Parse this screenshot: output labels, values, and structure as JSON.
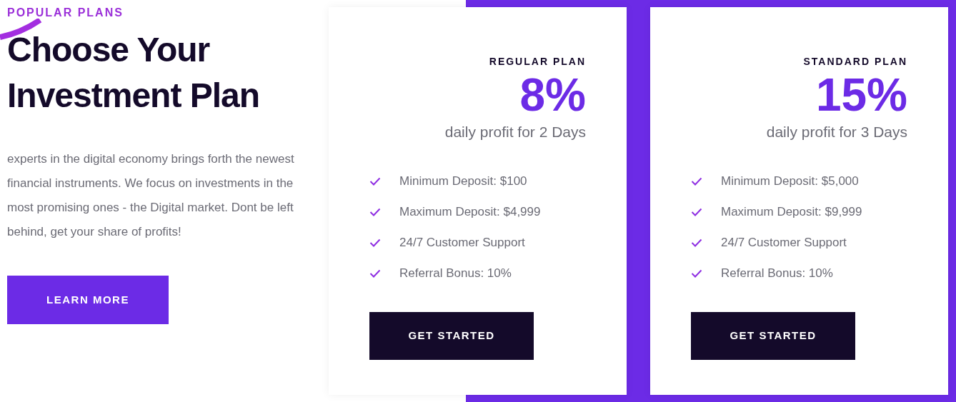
{
  "section": {
    "eyebrow": "POPULAR PLANS",
    "heading": "Choose Your Investment Plan",
    "text": "experts in the digital economy brings forth the newest financial instruments. We focus on investments in the most promising ones - the Digital market. Dont be left behind, get your share of profits!",
    "button": "LEARN MORE"
  },
  "plans": [
    {
      "name": "REGULAR PLAN",
      "rate": "8%",
      "period": "daily profit for 2 Days",
      "features": [
        "Minimum Deposit: $100",
        "Maximum Deposit: $4,999",
        "24/7 Customer Support",
        "Referral Bonus: 10%"
      ],
      "button": "GET STARTED"
    },
    {
      "name": "STANDARD PLAN",
      "rate": "15%",
      "period": "daily profit for 3 Days",
      "features": [
        "Minimum Deposit: $5,000",
        "Maximum Deposit: $9,999",
        "24/7 Customer Support",
        "Referral Bonus: 10%"
      ],
      "button": "GET STARTED"
    }
  ]
}
